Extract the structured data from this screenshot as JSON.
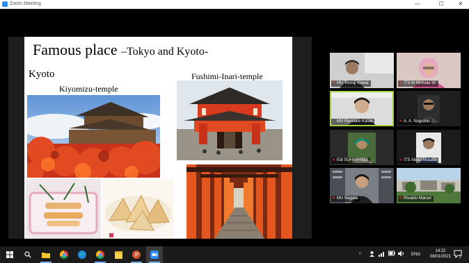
{
  "window": {
    "title": "Zoom Meeting",
    "controls": [
      "—",
      "☐",
      "✕"
    ]
  },
  "slide": {
    "title_main": "Famous place ",
    "title_sub": "–Tokyo and Kyoto-",
    "section": "Kyoto",
    "label_left": "Kiyomizu-temple",
    "label_right": "Fushimi-Inari-temple"
  },
  "participants": [
    {
      "name": "MU Toshiji Kawai",
      "muted": true
    },
    {
      "name": "ITS M Nirmala W.",
      "muted": true
    },
    {
      "name": "MU Ryosuke Kasai",
      "muted": false
    },
    {
      "name": "A. A. Nugroho",
      "muted": true
    },
    {
      "name": "Edi SUHARYADI",
      "muted": true
    },
    {
      "name": "ITS Abdul Mutalib",
      "muted": true
    },
    {
      "name": "MU Nagata",
      "muted": true
    },
    {
      "name": "Rivaldo Marsel",
      "muted": true
    }
  ],
  "taskbar": {
    "apps": [
      "start-icon",
      "search-icon",
      "file-explorer-icon",
      "chrome-icon",
      "edge-icon",
      "chrome-icon",
      "sticky-notes-icon",
      "powerpoint-icon",
      "zoom-icon"
    ],
    "tray_arrow": "^",
    "language": "ENG",
    "time": "14:22",
    "date": "08/01/2021",
    "notification_count": "2"
  },
  "colors": {
    "zoom_blue": "#2D8CFF",
    "active_speaker": "#a7d13f",
    "muted_red": "#ff4d4d"
  }
}
